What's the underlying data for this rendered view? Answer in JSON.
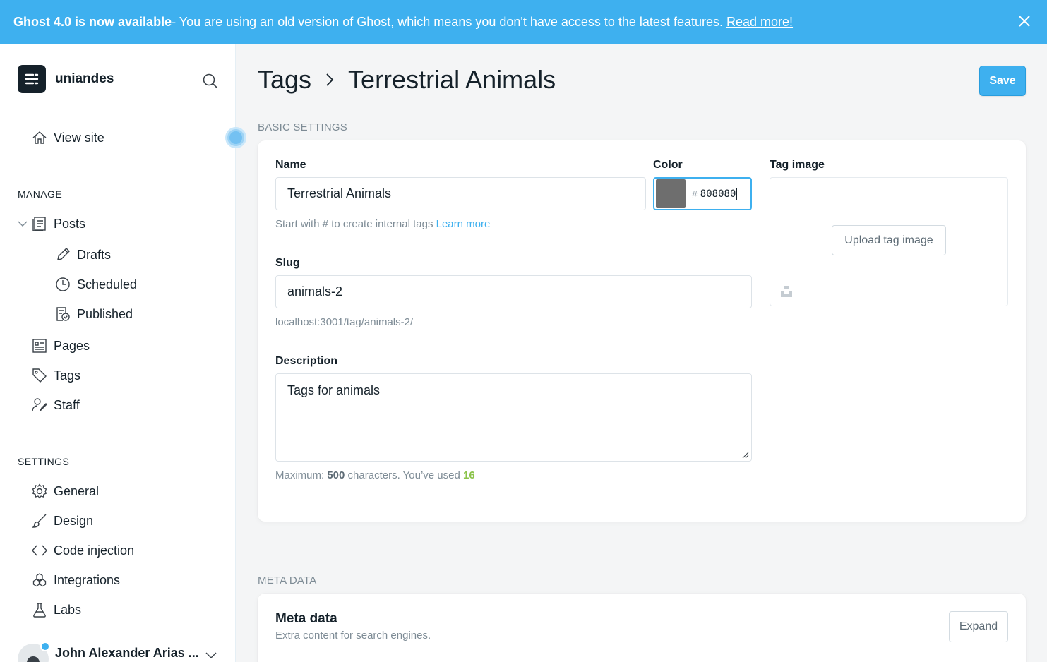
{
  "banner": {
    "title": "Ghost 4.0 is now available",
    "message": " - You are using an old version of Ghost, which means you don't have access to the latest features.",
    "link": "Read more!"
  },
  "sidebar": {
    "brand": "uniandes",
    "view_site": "View site",
    "manage_title": "MANAGE",
    "manage_items": {
      "posts": "Posts",
      "drafts": "Drafts",
      "scheduled": "Scheduled",
      "published": "Published",
      "pages": "Pages",
      "tags": "Tags",
      "staff": "Staff"
    },
    "settings_title": "SETTINGS",
    "settings_items": {
      "general": "General",
      "design": "Design",
      "code_injection": "Code injection",
      "integrations": "Integrations",
      "labs": "Labs"
    },
    "user_name": "John Alexander Arias ..."
  },
  "header": {
    "breadcrumb_parent": "Tags",
    "breadcrumb_current": "Terrestrial Animals",
    "save_label": "Save"
  },
  "basic_settings": {
    "group_label": "BASIC SETTINGS",
    "name_label": "Name",
    "name_value": "Terrestrial Animals",
    "name_hint": "Start with # to create internal tags",
    "name_hint_link": "Learn more",
    "color_label": "Color",
    "color_hash": "#",
    "color_value": "808080",
    "color_swatch": "#6e6e6e",
    "tag_image_label": "Tag image",
    "upload_label": "Upload tag image",
    "slug_label": "Slug",
    "slug_value": "animals-2",
    "slug_url": "localhost:3001/tag/animals-2/",
    "description_label": "Description",
    "description_value": "Tags for animals",
    "desc_hint_prefix": "Maximum:",
    "desc_hint_max": "500",
    "desc_hint_mid": "characters. You’ve used",
    "desc_hint_used": "16"
  },
  "meta": {
    "group_label": "META DATA",
    "title": "Meta data",
    "subtitle": "Extra content for search engines.",
    "expand_label": "Expand"
  },
  "colors": {
    "accent": "#3eb0ef",
    "counter_green": "#8bc34a"
  }
}
